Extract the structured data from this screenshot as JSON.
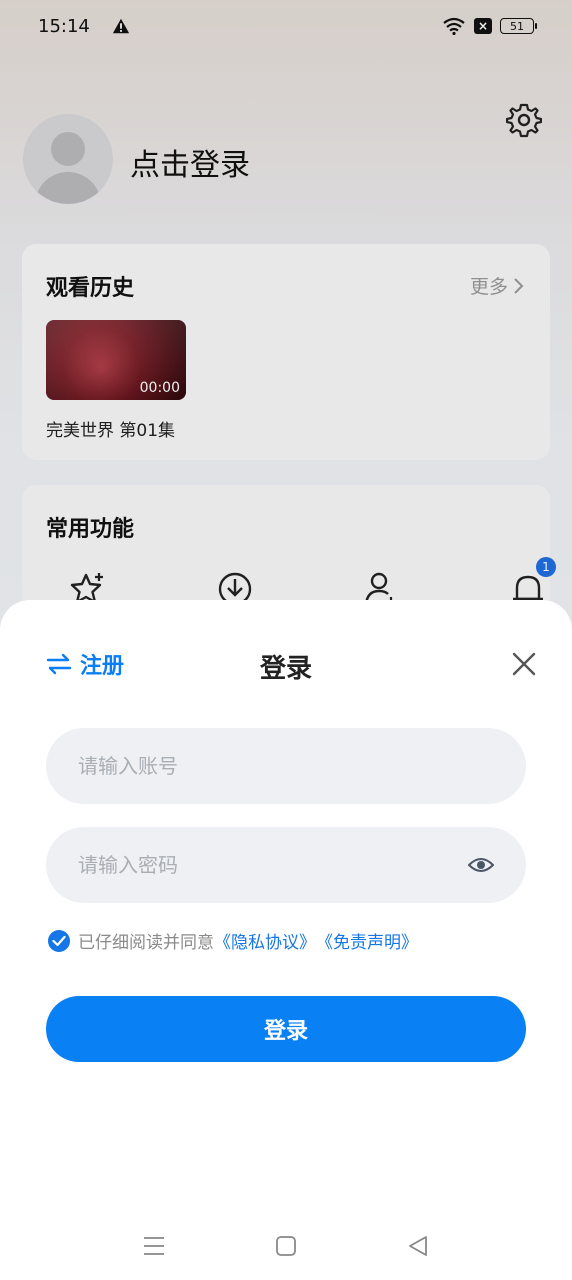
{
  "status_bar": {
    "time": "15:14",
    "battery": "51"
  },
  "profile": {
    "login_prompt": "点击登录"
  },
  "history": {
    "title": "观看历史",
    "more_label": "更多",
    "items": [
      {
        "title": "完美世界 第01集",
        "duration": "00:00"
      }
    ]
  },
  "functions": {
    "title": "常用功能",
    "notification_count": "1"
  },
  "sheet": {
    "register_label": "注册",
    "title": "登录",
    "account_placeholder": "请输入账号",
    "password_placeholder": "请输入密码",
    "agree_text": "已仔细阅读并同意",
    "privacy_link": "《隐私协议》",
    "disclaimer_link": "《免责声明》",
    "login_button": "登录"
  },
  "colors": {
    "accent": "#0a80f5",
    "link": "#1576e8"
  }
}
